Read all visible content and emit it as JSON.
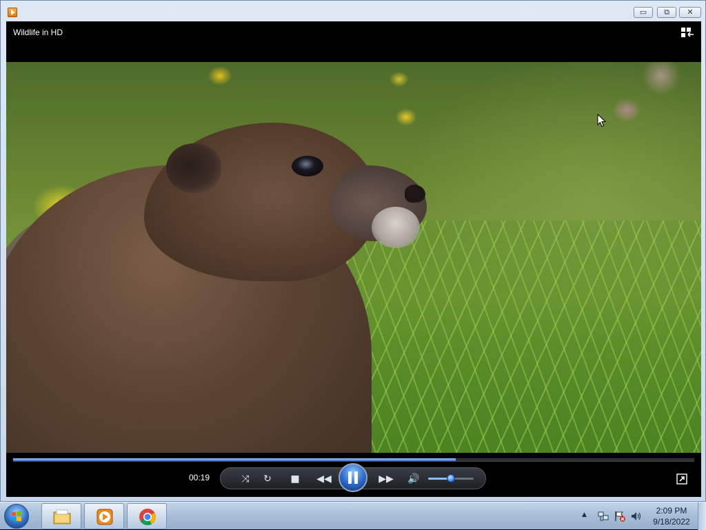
{
  "window": {
    "app_icon": "media-player-icon",
    "controls": {
      "minimize": "▭",
      "maximize": "⧉",
      "close": "✕"
    }
  },
  "player": {
    "now_playing_title": "Wildlife in HD",
    "elapsed_time": "00:19",
    "seek_progress": 0.65,
    "volume_level": 0.5,
    "state": "playing"
  },
  "controls": {
    "shuffle": "⤨",
    "repeat": "↻",
    "stop": "■",
    "previous": "◀◀",
    "next": "▶▶",
    "mute": "🔊"
  },
  "taskbar": {
    "apps": [
      "windows-explorer",
      "windows-media-player",
      "google-chrome"
    ],
    "tray_arrow": "▲",
    "clock_time": "2:09 PM",
    "clock_date": "9/18/2022"
  },
  "colors": {
    "accent": "#2d6fd1",
    "seek_fill": "#3d6fc4",
    "taskbar": "#a7bdd7"
  }
}
